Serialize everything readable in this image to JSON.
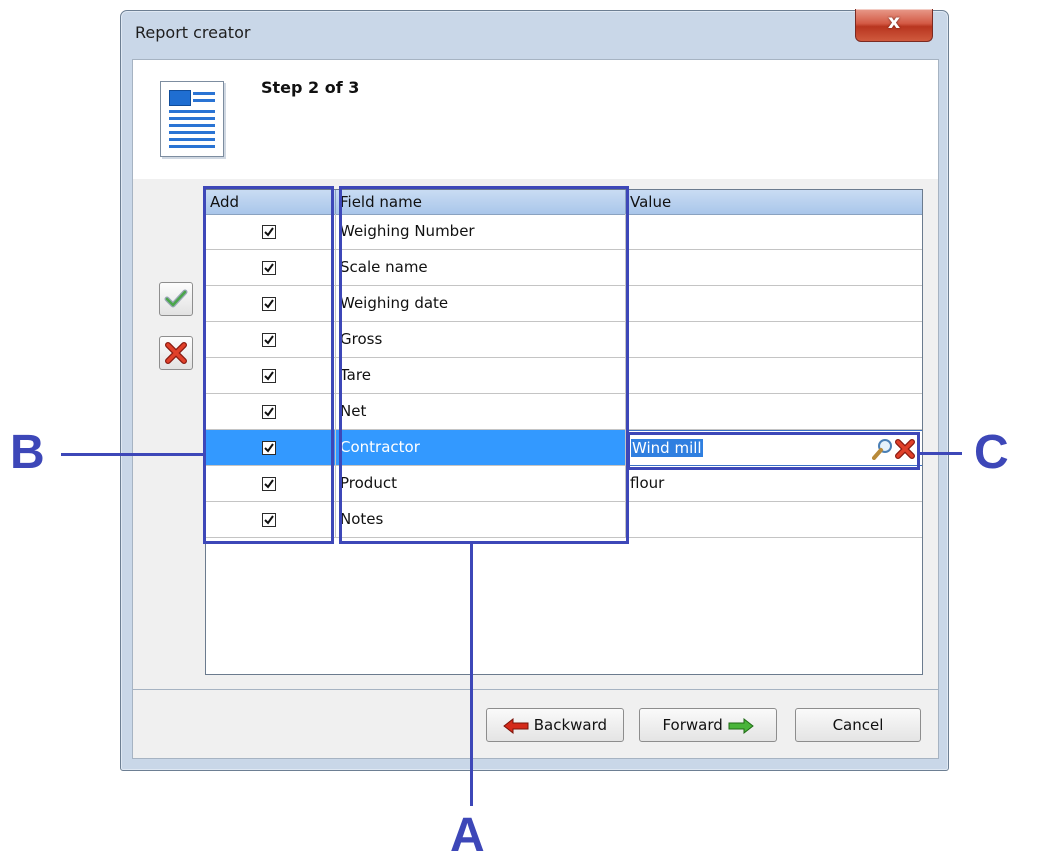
{
  "window": {
    "title": "Report creator",
    "close_glyph": "x"
  },
  "header": {
    "step_label": "Step 2 of 3",
    "icon": "report-icon"
  },
  "side_buttons": [
    {
      "name": "select-all-button",
      "icon": "checkmark-icon"
    },
    {
      "name": "clear-all-button",
      "icon": "red-x-icon"
    }
  ],
  "grid": {
    "columns": {
      "add": "Add",
      "field_name": "Field name",
      "value": "Value"
    },
    "rows": [
      {
        "checked": true,
        "field": "Weighing Number",
        "value": ""
      },
      {
        "checked": true,
        "field": "Scale name",
        "value": ""
      },
      {
        "checked": true,
        "field": "Weighing date",
        "value": ""
      },
      {
        "checked": true,
        "field": "Gross",
        "value": ""
      },
      {
        "checked": true,
        "field": "Tare",
        "value": ""
      },
      {
        "checked": true,
        "field": "Net",
        "value": ""
      },
      {
        "checked": true,
        "field": "Contractor",
        "value": "Wind mill",
        "selected": true
      },
      {
        "checked": true,
        "field": "Product",
        "value": "flour"
      },
      {
        "checked": true,
        "field": "Notes",
        "value": ""
      }
    ]
  },
  "footer": {
    "backward_label": "Backward",
    "forward_label": "Forward",
    "cancel_label": "Cancel"
  },
  "annotations": {
    "a": "A",
    "b": "B",
    "c": "C"
  },
  "colors": {
    "annotation": "#3d47b8",
    "selection": "#3399ff"
  }
}
